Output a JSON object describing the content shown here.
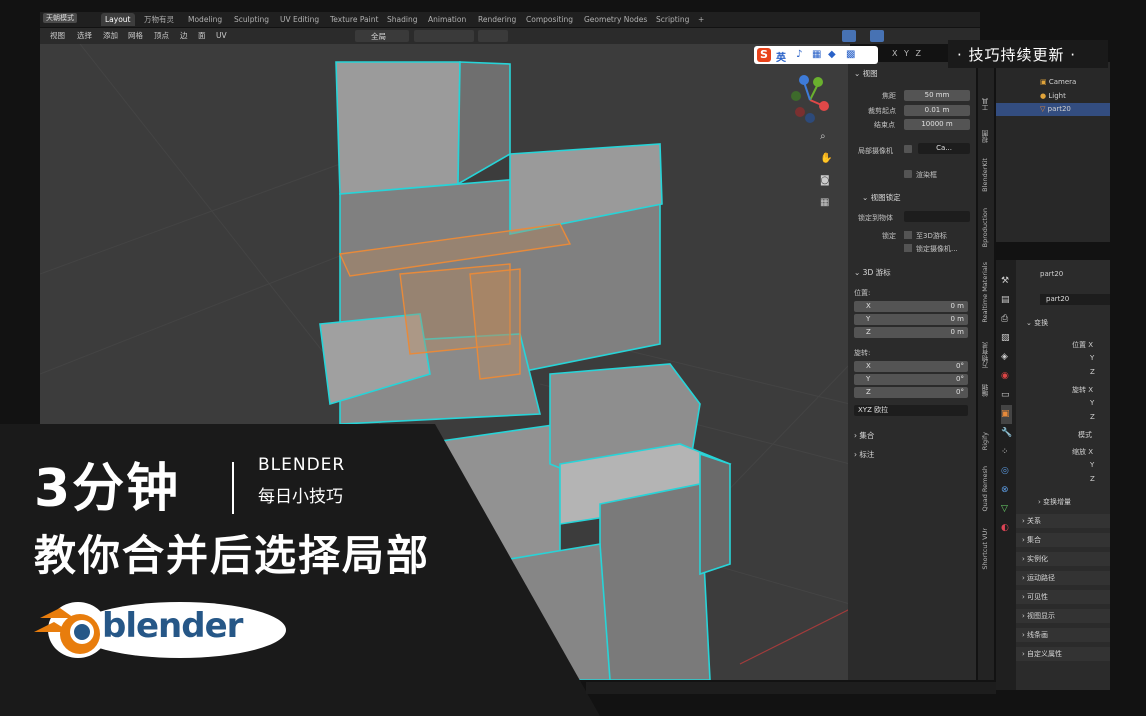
{
  "topbar": {
    "mode": "天朝模式",
    "tabs": [
      "Layout",
      "万物有灵",
      "Modeling",
      "Sculpting",
      "UV Editing",
      "Texture Paint",
      "Shading",
      "Animation",
      "Rendering",
      "Compositing",
      "Geometry Nodes",
      "Scripting"
    ],
    "add": "+"
  },
  "menubar": {
    "items": [
      "视图",
      "选择",
      "添加",
      "网格",
      "顶点",
      "边",
      "面",
      "UV"
    ],
    "transform_orientation": "全局"
  },
  "npanel": {
    "view_header": "视图",
    "focal_label": "焦距",
    "focal_value": "50 mm",
    "clip_start_label": "裁剪起点",
    "clip_start_value": "0.01 m",
    "clip_end_label": "结束点",
    "clip_end_value": "10000 m",
    "local_camera_label": "局部摄像机",
    "local_camera_value": "Ca...",
    "render_region_label": "渲染框",
    "view_lock_header": "视图锁定",
    "lock_object_label": "锁定到物体",
    "lock_label": "锁定",
    "lock_3d_cursor": "至3D游标",
    "lock_camera": "锁定摄像机...",
    "cursor_header": "3D 游标",
    "position_label": "位置:",
    "pos_x_label": "X",
    "pos_x": "0 m",
    "pos_y_label": "Y",
    "pos_y": "0 m",
    "pos_z_label": "Z",
    "pos_z": "0 m",
    "rotation_label": "旋转:",
    "rot_x_label": "X",
    "rot_x": "0°",
    "rot_y_label": "Y",
    "rot_y": "0°",
    "rot_z_label": "Z",
    "rot_z": "0°",
    "rot_mode": "XYZ 欧拉",
    "collection_header": "集合",
    "annotation_header": "标注"
  },
  "sidebar_tabs": [
    "工具",
    "视图",
    "BlenderKit",
    "Bproduction",
    "Realtime Materials",
    "万物有灵",
    "编辑",
    "Rigify",
    "Quad Remesh",
    "Shortcut VUr"
  ],
  "outliner": {
    "items": [
      "Camera",
      "Light",
      "part20"
    ]
  },
  "properties": {
    "object_name": "part20",
    "data_name": "part20",
    "transform_header": "变换",
    "location_label": "位置 X",
    "loc_y": "Y",
    "loc_z": "Z",
    "rotation_label": "旋转 X",
    "rot_y": "Y",
    "rot_z": "Z",
    "mode_label": "模式",
    "scale_label": "缩放 X",
    "scale_y": "Y",
    "scale_z": "Z",
    "delta_header": "变换增量",
    "sections": [
      "关系",
      "集合",
      "实例化",
      "运动路径",
      "可见性",
      "视图显示",
      "线条画",
      "自定义属性"
    ]
  },
  "ime": {
    "label": "英"
  },
  "axis_labels": {
    "x": "X",
    "y": "Y",
    "z": "Z"
  },
  "overlay": {
    "title_line1": "3分钟",
    "title_line2": "教你合并后选择局部",
    "brand": "BLENDER",
    "subtitle": "每日小技巧",
    "logo_text": "blender",
    "badge": "· 技巧持续更新 ·"
  },
  "colors": {
    "accent_cyan": "#27d4d8",
    "selection_orange": "#e88a3a",
    "active_tab": "#3d3d3d",
    "overlay_bg": "#1a1a1a",
    "logo_orange": "#e87d0d",
    "logo_blue": "#265787"
  }
}
